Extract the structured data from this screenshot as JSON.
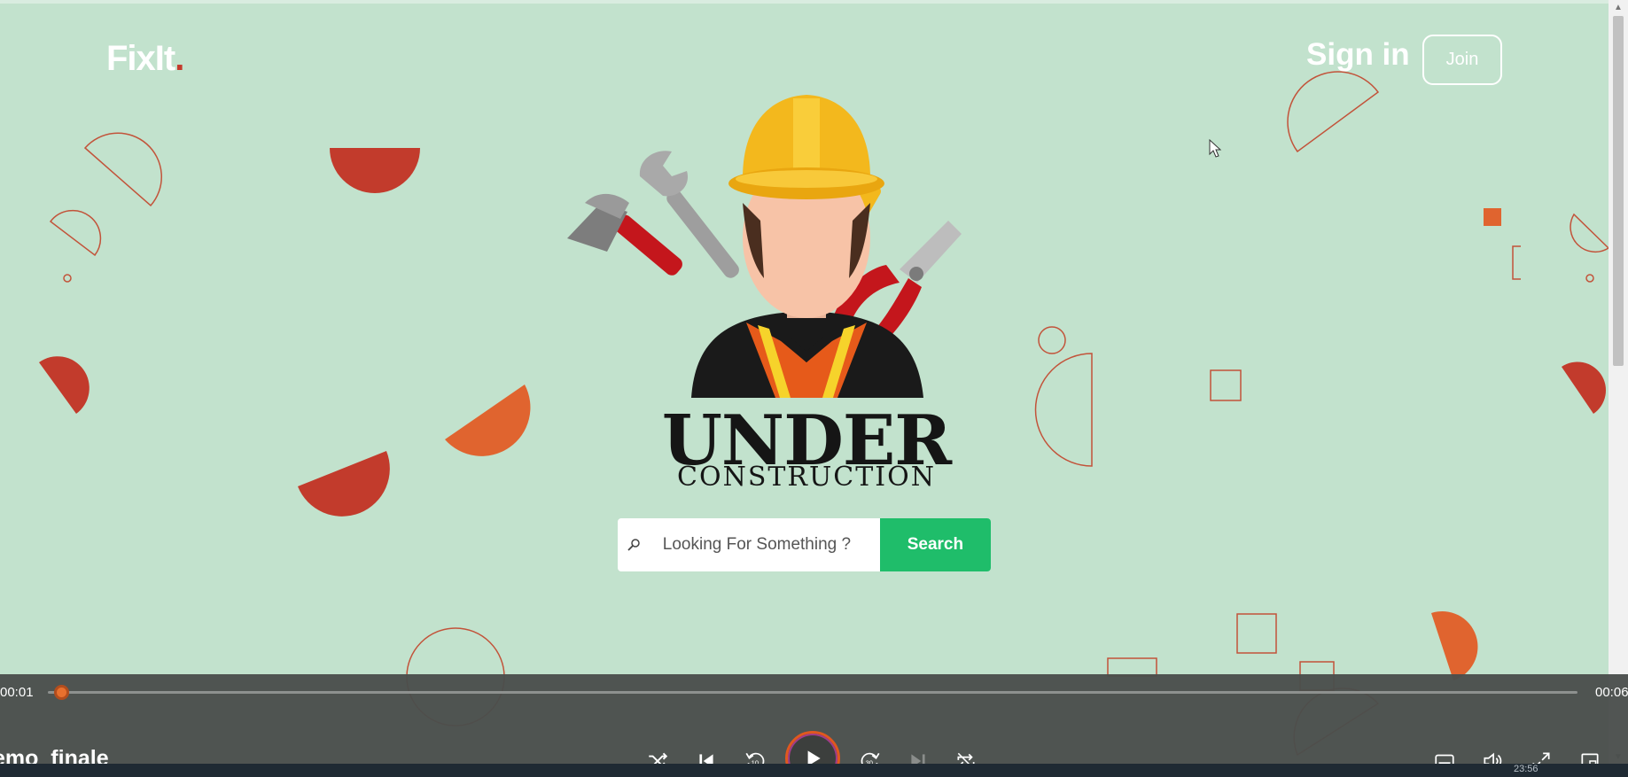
{
  "header": {
    "logo_text": "FixIt",
    "logo_dot": ".",
    "signin_label": "Sign in",
    "join_label": "Join"
  },
  "hero": {
    "title_main": "UNDER",
    "title_sub": "CONSTRUCTION"
  },
  "search": {
    "placeholder": "Looking For Something ?",
    "button_label": "Search",
    "icon": "search-icon"
  },
  "player": {
    "time_current": "00:01",
    "time_total": "00:06",
    "progress": 0.0,
    "title": "emo_finale",
    "controls": [
      "shuffle-icon",
      "previous-icon",
      "rewind-10-icon",
      "play-icon",
      "forward-30-icon",
      "next-icon",
      "repeat-icon",
      "subtitles-icon",
      "volume-icon",
      "fullscreen-icon",
      "miniplayer-icon"
    ]
  },
  "taskbar": {
    "clock": "23:56"
  },
  "colors": {
    "background": "#c2e2cd",
    "accent_red": "#c43a2c",
    "accent_orange": "#e0642f",
    "search_button": "#1fbd6a",
    "player_bar": "#4a4e4c"
  }
}
